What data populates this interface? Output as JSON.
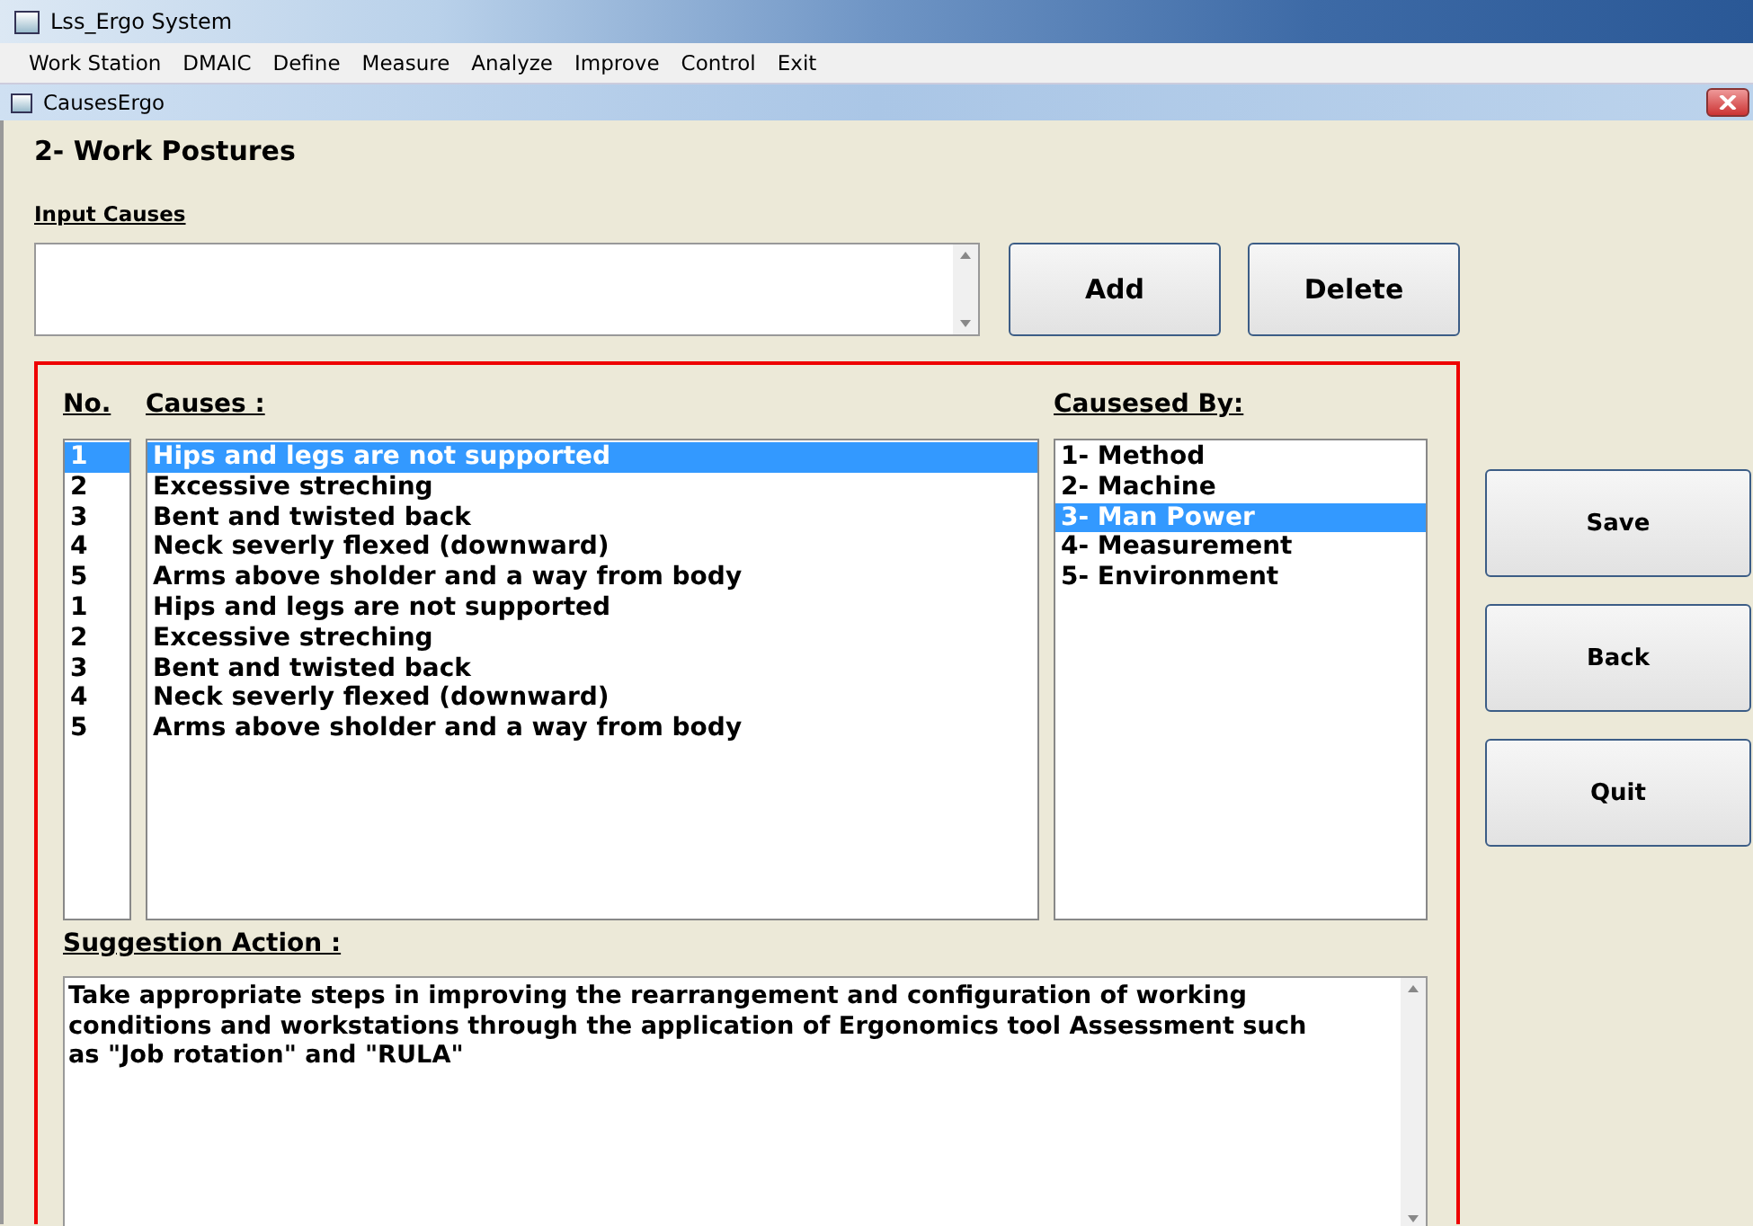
{
  "window": {
    "title": "Lss_Ergo System"
  },
  "menu": [
    "Work Station",
    "DMAIC",
    "Define",
    "Measure",
    "Analyze",
    "Improve",
    "Control",
    "Exit"
  ],
  "child_window": {
    "title": "CausesErgo"
  },
  "heading": "2- Work Postures",
  "input_causes": {
    "label": "Input Causes"
  },
  "input_buttons": [
    "Add",
    "Delete"
  ],
  "causes": {
    "no_header": "No.",
    "causes_header": "Causes :",
    "rows": [
      {
        "no": "1",
        "cause": "Hips and legs are not supported",
        "selected": true
      },
      {
        "no": "2",
        "cause": "Excessive streching",
        "selected": false
      },
      {
        "no": "3",
        "cause": "Bent and twisted back",
        "selected": false
      },
      {
        "no": "4",
        "cause": "Neck severly flexed (downward)",
        "selected": false
      },
      {
        "no": "5",
        "cause": "Arms above sholder and a way from body",
        "selected": false
      },
      {
        "no": "1",
        "cause": "Hips and legs are not supported",
        "selected": false
      },
      {
        "no": "2",
        "cause": "Excessive streching",
        "selected": false
      },
      {
        "no": "3",
        "cause": "Bent and twisted back",
        "selected": false
      },
      {
        "no": "4",
        "cause": "Neck severly flexed (downward)",
        "selected": false
      },
      {
        "no": "5",
        "cause": "Arms above sholder and a way from body",
        "selected": false
      }
    ]
  },
  "caused_by": {
    "header": "Causesed By:",
    "items": [
      {
        "label": "1- Method",
        "selected": false
      },
      {
        "label": "2- Machine",
        "selected": false
      },
      {
        "label": "3- Man Power",
        "selected": true
      },
      {
        "label": "4- Measurement",
        "selected": false
      },
      {
        "label": "5- Environment",
        "selected": false
      }
    ]
  },
  "suggestion": {
    "label": "Suggestion Action :",
    "text": "Take appropriate steps in improving the rearrangement and configuration of working conditions and workstations through the application of Ergonomics tool Assessment such as \"Job rotation\" and \"RULA\""
  },
  "side_buttons": [
    "Save",
    "Back",
    "Quit"
  ]
}
